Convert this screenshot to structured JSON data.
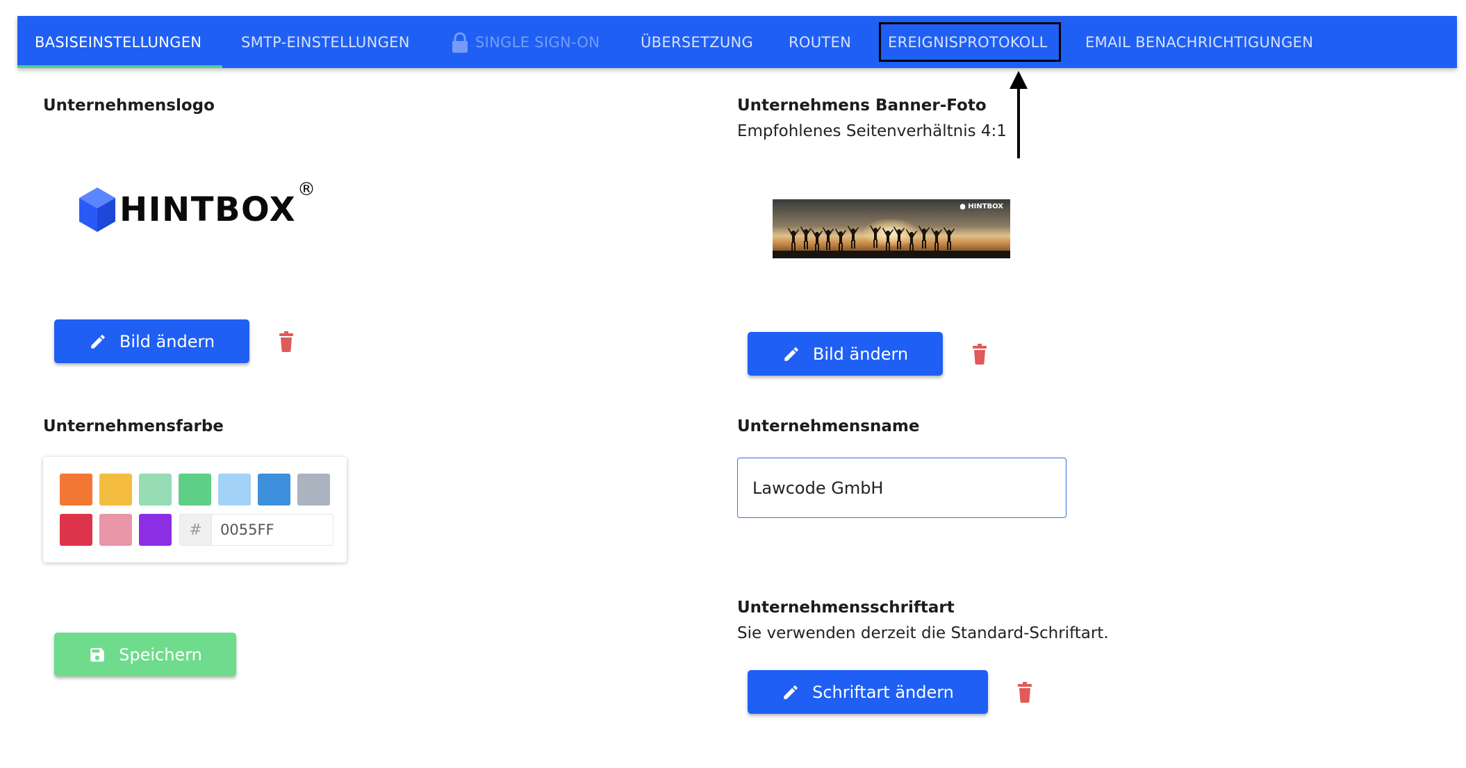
{
  "tabs": [
    {
      "label": "BASISEINSTELLUNGEN",
      "state": "active"
    },
    {
      "label": "SMTP-EINSTELLUNGEN",
      "state": "normal"
    },
    {
      "label": "SINGLE SIGN-ON",
      "state": "disabled",
      "icon": "lock-icon"
    },
    {
      "label": "ÜBERSETZUNG",
      "state": "normal"
    },
    {
      "label": "ROUTEN",
      "state": "normal"
    },
    {
      "label": "EREIGNISPROTOKOLL",
      "state": "highlighted"
    },
    {
      "label": "EMAIL BENACHRICHTIGUNGEN",
      "state": "normal"
    }
  ],
  "logo_section": {
    "label": "Unternehmenslogo",
    "logo_text": "HINTBOX",
    "logo_mark": "®",
    "change_button": "Bild ändern",
    "delete_icon": "trash-icon"
  },
  "banner_section": {
    "label": "Unternehmens Banner-Foto",
    "hint": "Empfohlenes Seitenverhältnis 4:1",
    "banner_brand": "HINTBOX",
    "change_button": "Bild ändern",
    "delete_icon": "trash-icon"
  },
  "color_section": {
    "label": "Unternehmensfarbe",
    "swatches": [
      "#f27734",
      "#f4bd42",
      "#95dcb5",
      "#5fce87",
      "#a2d2f8",
      "#3d90dc",
      "#a9b4be",
      "#dd344b",
      "#e896a8",
      "#8c2ee3"
    ],
    "hex_prefix": "#",
    "hex_value": "0055FF"
  },
  "name_section": {
    "label": "Unternehmensname",
    "value": "Lawcode GmbH"
  },
  "font_section": {
    "label": "Unternehmensschriftart",
    "hint": "Sie verwenden derzeit die Standard-Schriftart.",
    "change_button": "Schriftart ändern",
    "delete_icon": "trash-icon"
  },
  "save_button": "Speichern",
  "colors": {
    "tabbar": "#1f5ff4",
    "primary_button": "#1f5ff4",
    "save_button": "#6edc8c",
    "delete": "#e05a5a",
    "active_indicator": "#4cd08a"
  }
}
